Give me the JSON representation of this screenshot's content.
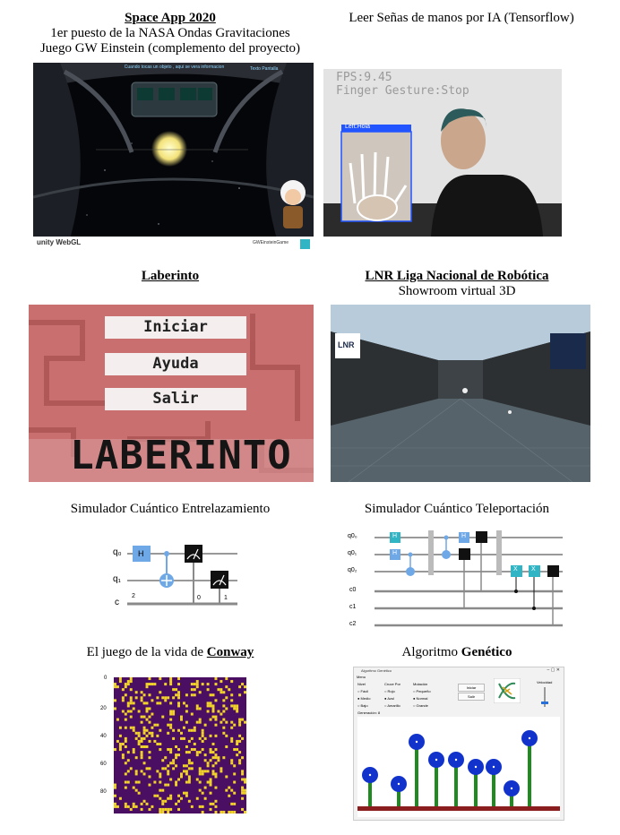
{
  "projects": [
    {
      "title": "Space App 2020",
      "lines": [
        "1er puesto de la NASA Ondas Gravitaciones",
        "Juego GW Einstein (complemento del proyecto)"
      ],
      "hud_text": "Cuando tocas un objeto , aqui se vera informacion",
      "hud_right": "Texto Pantalla",
      "footer_left": "unity WebGL",
      "footer_right": "GWEinsteinGame"
    },
    {
      "title": "Leer Señas de manos por IA (Tensorflow)",
      "fps": "FPS:9.45",
      "gesture": "Finger Gesture:Stop",
      "hand_label": "Left:Hola"
    },
    {
      "title": "Laberinto",
      "buttons": [
        "Iniciar",
        "Ayuda",
        "Salir"
      ],
      "big_text": "LABERINTO"
    },
    {
      "title": "LNR Liga Nacional de Robótica",
      "subtitle": "Showroom virtual 3D",
      "logo": "LNR"
    },
    {
      "title": "Simulador Cuántico Entrelazamiento",
      "qubits": [
        "q₀",
        "q₁"
      ],
      "classical": "c",
      "classical_count": "2",
      "gates": [
        "H"
      ],
      "measure_labels": [
        "0",
        "1"
      ]
    },
    {
      "title": "Simulador Cuántico Teleportación",
      "qubits": [
        "q0₀",
        "q0₁",
        "q0₂"
      ],
      "classical": [
        "c0",
        "c1",
        "c2"
      ],
      "gates": [
        "H",
        "H",
        "H",
        "X",
        "X"
      ]
    },
    {
      "title_prefix": "El juego de la vida de ",
      "title_bold": "Conway",
      "y_ticks": [
        "0",
        "20",
        "40",
        "60",
        "80"
      ]
    },
    {
      "title_prefix": "Algoritmo ",
      "title_bold": "Genético",
      "window_title": "Algoritmo Genético",
      "menu": "Menu",
      "groups": [
        "Nivel",
        "Cruce Por",
        "Mutación"
      ],
      "options": [
        [
          "Fácil",
          "Medio",
          "Bajo"
        ],
        [
          "Rojo",
          "Azul",
          "Amarillo"
        ],
        [
          "Pequeño",
          "Normal",
          "Grande"
        ]
      ],
      "buttons": [
        "Iniciar",
        "Salir"
      ],
      "velocity": "Velocidad",
      "generation": "Generación: 8"
    }
  ],
  "colors": {
    "cyan": "#31b4c4",
    "blue_gate": "#6fa8e6",
    "ga_flower": "#1133cc",
    "ga_stem": "#1f8a1f",
    "ga_ground": "#8a1d1d",
    "maze_bg": "#c96f6f",
    "conway_bg": "#4a0e63",
    "conway_cell": "#f2d32a"
  }
}
